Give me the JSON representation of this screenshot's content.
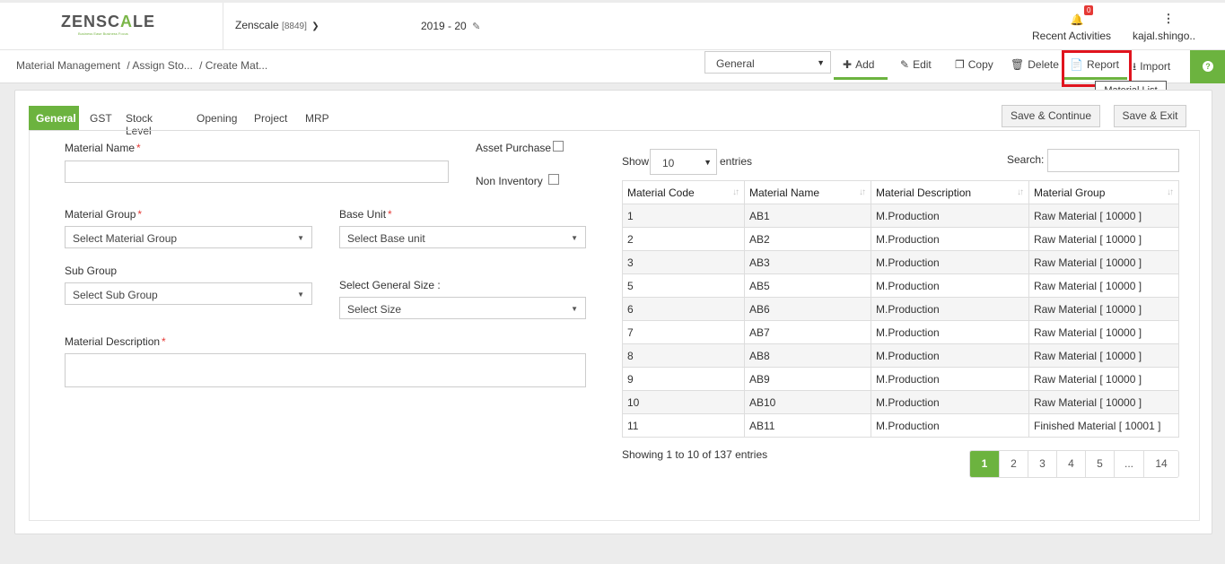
{
  "header": {
    "logo_text_a": "ZENSC",
    "logo_text_b": "A",
    "logo_text_c": "LE",
    "logo_tagline": "Business Ease Business Focus",
    "company": "Zenscale",
    "company_code": "[8849]",
    "financial_year": "2019 - 20",
    "notifications_count": "0",
    "recent_activities": "Recent Activities",
    "user": "kajal.shingo.."
  },
  "breadcrumb": {
    "root": "Material Management",
    "mid": "/ Assign Sto...",
    "current": "/ Create Mat..."
  },
  "toolbar": {
    "view_select": "General",
    "add": "Add",
    "edit": "Edit",
    "copy": "Copy",
    "delete": "Delete",
    "report": "Report",
    "import": "Import",
    "tooltip": "Material List"
  },
  "tabs": [
    "General",
    "GST",
    "Stock Level",
    "Opening",
    "Project",
    "MRP"
  ],
  "actions": {
    "save_continue": "Save & Continue",
    "save_exit": "Save & Exit"
  },
  "form": {
    "material_name": "Material Name",
    "asset_purchase": "Asset Purchase",
    "non_inventory": "Non Inventory",
    "material_group": "Material Group",
    "material_group_ph": "Select Material Group",
    "base_unit": "Base Unit",
    "base_unit_ph": "Select Base unit",
    "sub_group": "Sub Group",
    "sub_group_ph": "Select Sub Group",
    "general_size": "Select General Size :",
    "general_size_ph": "Select Size",
    "material_description": "Material Description",
    "required_mark": "*"
  },
  "table": {
    "show": "Show",
    "length": "10",
    "entries": "entries",
    "search": "Search:",
    "columns": [
      "Material Code",
      "Material Name",
      "Material Description",
      "Material Group"
    ],
    "rows": [
      [
        "1",
        "AB1",
        "M.Production",
        "Raw Material [ 10000 ]"
      ],
      [
        "2",
        "AB2",
        "M.Production",
        "Raw Material [ 10000 ]"
      ],
      [
        "3",
        "AB3",
        "M.Production",
        "Raw Material [ 10000 ]"
      ],
      [
        "5",
        "AB5",
        "M.Production",
        "Raw Material [ 10000 ]"
      ],
      [
        "6",
        "AB6",
        "M.Production",
        "Raw Material [ 10000 ]"
      ],
      [
        "7",
        "AB7",
        "M.Production",
        "Raw Material [ 10000 ]"
      ],
      [
        "8",
        "AB8",
        "M.Production",
        "Raw Material [ 10000 ]"
      ],
      [
        "9",
        "AB9",
        "M.Production",
        "Raw Material [ 10000 ]"
      ],
      [
        "10",
        "AB10",
        "M.Production",
        "Raw Material [ 10000 ]"
      ],
      [
        "11",
        "AB11",
        "M.Production",
        "Finished Material [ 10001 ]"
      ]
    ],
    "info": "Showing 1 to 10 of 137 entries",
    "pages": [
      "1",
      "2",
      "3",
      "4",
      "5",
      "...",
      "14"
    ],
    "active_page": "1"
  },
  "colors": {
    "accent": "#6cb33f",
    "highlight": "#e0141e"
  }
}
